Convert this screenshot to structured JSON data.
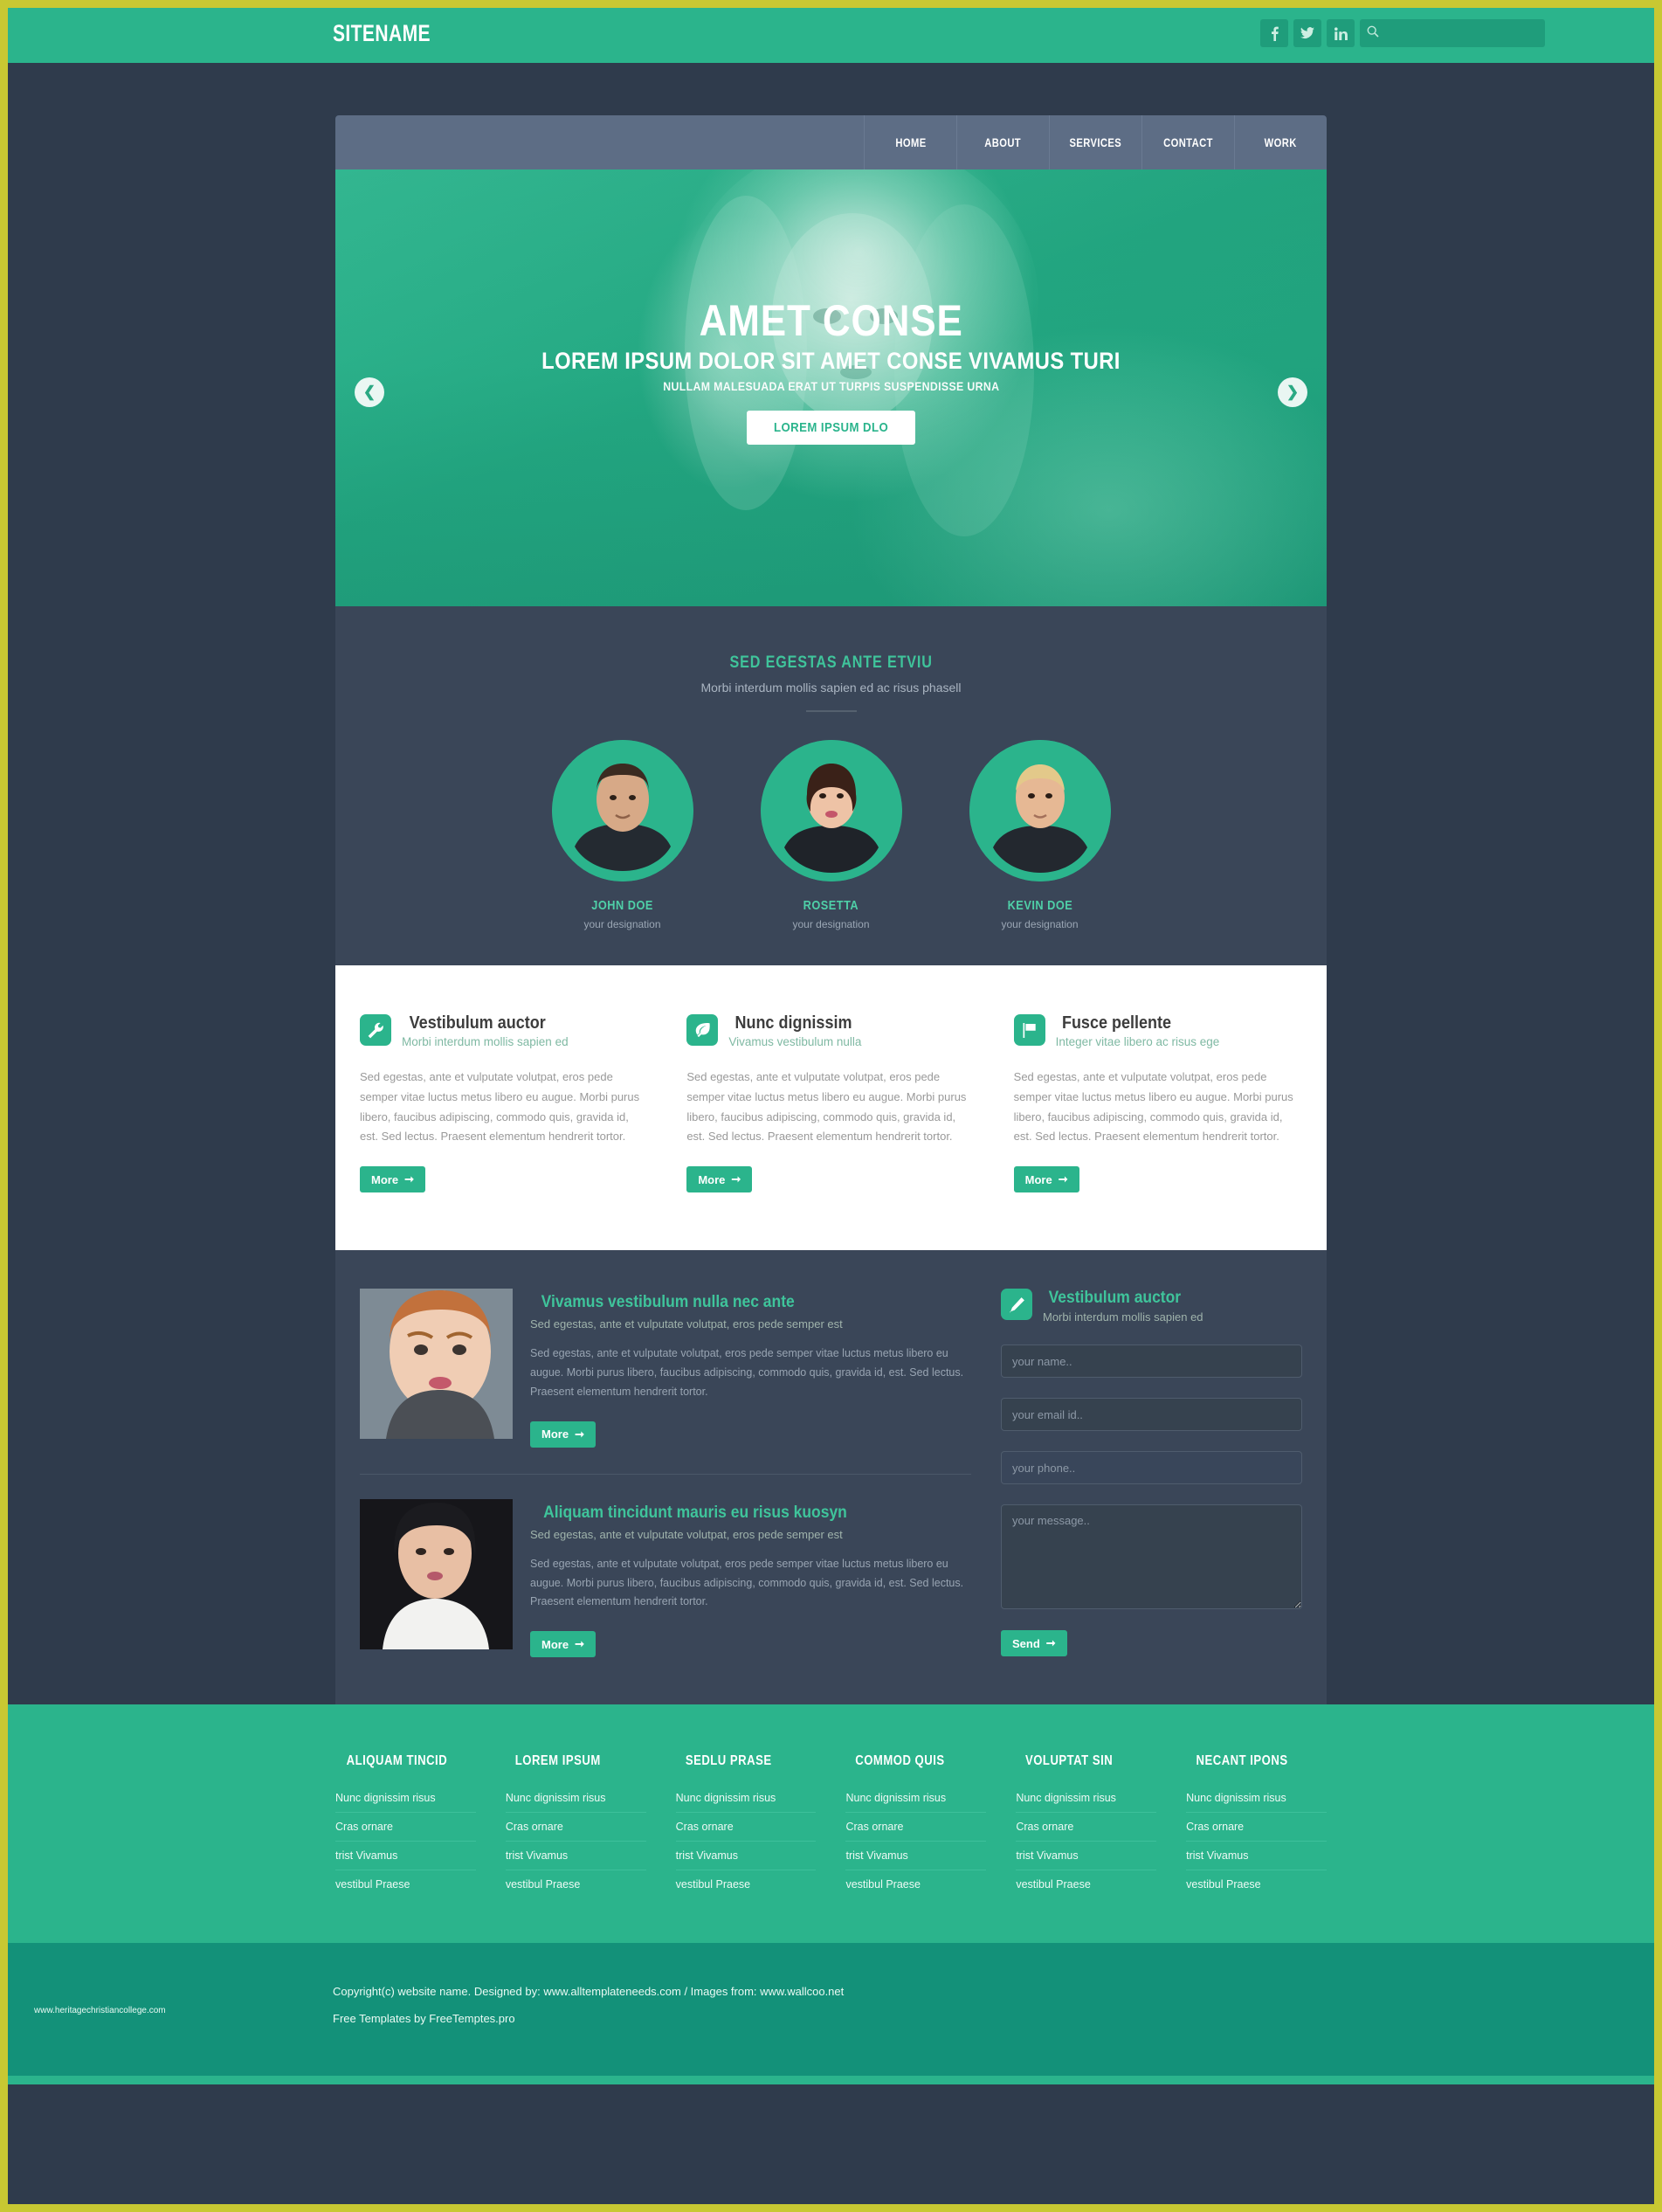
{
  "theme": {
    "accent": "#2bb48c",
    "dark": "#2f3b4c",
    "panel": "#3a4658",
    "nav": "#5d6d85",
    "border": "#c8c832"
  },
  "topbar": {
    "brand": "SITENAME",
    "social": [
      {
        "name": "facebook-icon",
        "glyph": "f"
      },
      {
        "name": "twitter-icon",
        "glyph": "t"
      },
      {
        "name": "linkedin-icon",
        "glyph": "in"
      }
    ],
    "search": {
      "icon": "search-icon",
      "placeholder": "",
      "value": ""
    }
  },
  "nav": {
    "items": [
      "HOME",
      "ABOUT",
      "SERVICES",
      "CONTACT",
      "WORK"
    ]
  },
  "hero": {
    "title": "AMET CONSE",
    "subtitle": "LOREM IPSUM DOLOR SIT AMET CONSE VIVAMUS TURI",
    "tagline": "NULLAM MALESUADA ERAT UT TURPIS SUSPENDISSE URNA",
    "button": "LOREM IPSUM DLO",
    "prev": "❮",
    "next": "❯"
  },
  "team": {
    "heading": "SED EGESTAS ANTE ETVIU",
    "subheading": "Morbi interdum mollis sapien ed ac risus phasell",
    "members": [
      {
        "name": "JOHN DOE",
        "role": "your designation"
      },
      {
        "name": "ROSETTA",
        "role": "your designation"
      },
      {
        "name": "KEVIN DOE",
        "role": "your designation"
      }
    ]
  },
  "features": {
    "more_label": "More",
    "items": [
      {
        "icon": "wrench-icon",
        "title": "Vestibulum auctor",
        "subtitle": "Morbi interdum mollis sapien ed",
        "body": "Sed egestas, ante et vulputate volutpat, eros pede semper vitae luctus metus libero eu augue. Morbi purus libero, faucibus adipiscing, commodo quis, gravida id, est. Sed lectus. Praesent elementum hendrerit tortor."
      },
      {
        "icon": "leaf-icon",
        "title": "Nunc dignissim",
        "subtitle": "Vivamus vestibulum nulla",
        "body": "Sed egestas, ante et vulputate volutpat, eros pede semper vitae luctus metus libero eu augue. Morbi purus libero, faucibus adipiscing, commodo quis, gravida id, est. Sed lectus. Praesent elementum hendrerit tortor."
      },
      {
        "icon": "flag-icon",
        "title": "Fusce pellente",
        "subtitle": "Integer vitae libero ac risus ege",
        "body": "Sed egestas, ante et vulputate volutpat, eros pede semper vitae luctus metus libero eu augue. Morbi purus libero, faucibus adipiscing, commodo quis, gravida id, est. Sed lectus. Praesent elementum hendrerit tortor."
      }
    ]
  },
  "blog": {
    "more_label": "More",
    "posts": [
      {
        "title": "Vivamus vestibulum nulla nec ante",
        "subtitle": "Sed egestas, ante et vulputate volutpat, eros pede semper est",
        "body": "Sed egestas, ante et vulputate volutpat, eros pede semper vitae luctus metus libero eu augue. Morbi purus libero, faucibus adipiscing, commodo quis, gravida id, est. Sed lectus. Praesent elementum hendrerit tortor."
      },
      {
        "title": "Aliquam tincidunt mauris eu risus kuosyn",
        "subtitle": "Sed egestas, ante et vulputate volutpat, eros pede semper est",
        "body": "Sed egestas, ante et vulputate volutpat, eros pede semper vitae luctus metus libero eu augue. Morbi purus libero, faucibus adipiscing, commodo quis, gravida id, est. Sed lectus. Praesent elementum hendrerit tortor."
      }
    ]
  },
  "contact": {
    "icon": "pencil-icon",
    "title": "Vestibulum auctor",
    "subtitle": "Morbi interdum mollis sapien ed",
    "name_placeholder": "your name..",
    "email_placeholder": "your email id..",
    "phone_placeholder": "your phone..",
    "message_placeholder": "your message..",
    "send_label": "Send"
  },
  "footer": {
    "columns": [
      {
        "heading": "ALIQUAM TINCID",
        "links": [
          "Nunc dignissim risus",
          "Cras ornare",
          "trist Vivamus",
          "vestibul Praese"
        ]
      },
      {
        "heading": "LOREM IPSUM",
        "links": [
          "Nunc dignissim risus",
          "Cras ornare",
          "trist Vivamus",
          "vestibul Praese"
        ]
      },
      {
        "heading": "SEDLU PRASE",
        "links": [
          "Nunc dignissim risus",
          "Cras ornare",
          "trist Vivamus",
          "vestibul Praese"
        ]
      },
      {
        "heading": "COMMOD QUIS",
        "links": [
          "Nunc dignissim risus",
          "Cras ornare",
          "trist Vivamus",
          "vestibul Praese"
        ]
      },
      {
        "heading": "VOLUPTAT SIN",
        "links": [
          "Nunc dignissim risus",
          "Cras ornare",
          "trist Vivamus",
          "vestibul Praese"
        ]
      },
      {
        "heading": "NECANT IPONS",
        "links": [
          "Nunc dignissim risus",
          "Cras ornare",
          "trist Vivamus",
          "vestibul Praese"
        ]
      }
    ],
    "watermark": "www.heritagechristiancollege.com",
    "copyright": "Copyright(c) website name. Designed by: www.alltemplateneeds.com / Images from: www.wallcoo.net",
    "credit": "Free Templates by FreeTemptes.pro"
  }
}
